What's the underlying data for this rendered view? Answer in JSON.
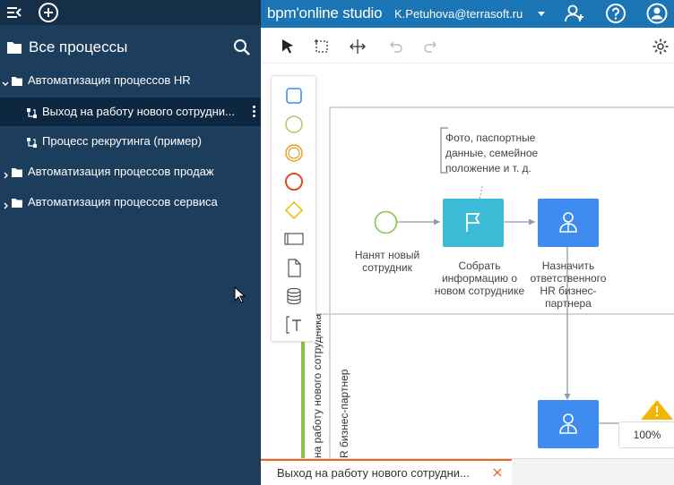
{
  "app": {
    "brand": "bpm'online studio",
    "user_email": "K.Petuhova@terrasoft.ru"
  },
  "sidebar": {
    "header_title": "Все процессы",
    "groups": [
      {
        "label": "Автоматизация процессов HR",
        "expanded": true
      },
      {
        "label": "Автоматизация процессов продаж",
        "expanded": false
      },
      {
        "label": "Автоматизация процессов сервиса",
        "expanded": false
      }
    ],
    "processes": [
      {
        "label": "Выход на работу нового сотрудни...",
        "active": true
      },
      {
        "label": "Процесс рекрутинга (пример)",
        "active": false
      }
    ]
  },
  "diagram": {
    "annotation": [
      "Фото, паспортные",
      "данные, семейное",
      "положение и т. д."
    ],
    "start_event_label": [
      "Нанят новый",
      "сотрудник"
    ],
    "task1_label": [
      "Собрать",
      "информацию о",
      "новом сотруднике"
    ],
    "task2_label": [
      "Назначить",
      "ответственного",
      "HR бизнес-",
      "партнера"
    ],
    "lane1_label": "на работу нового сотрудника",
    "lane2_label": "R бизнес-партнер"
  },
  "zoom_level": "100%",
  "bottom_tab": {
    "label": "Выход на работу нового сотрудни..."
  },
  "colors": {
    "sidebar_bg": "#1c3d5c",
    "topbar_bg": "#1b74b4",
    "task_teal": "#3bbbd6",
    "task_blue": "#3f8cf0",
    "start_green": "#8bc34a",
    "tab_accent": "#f26522"
  }
}
